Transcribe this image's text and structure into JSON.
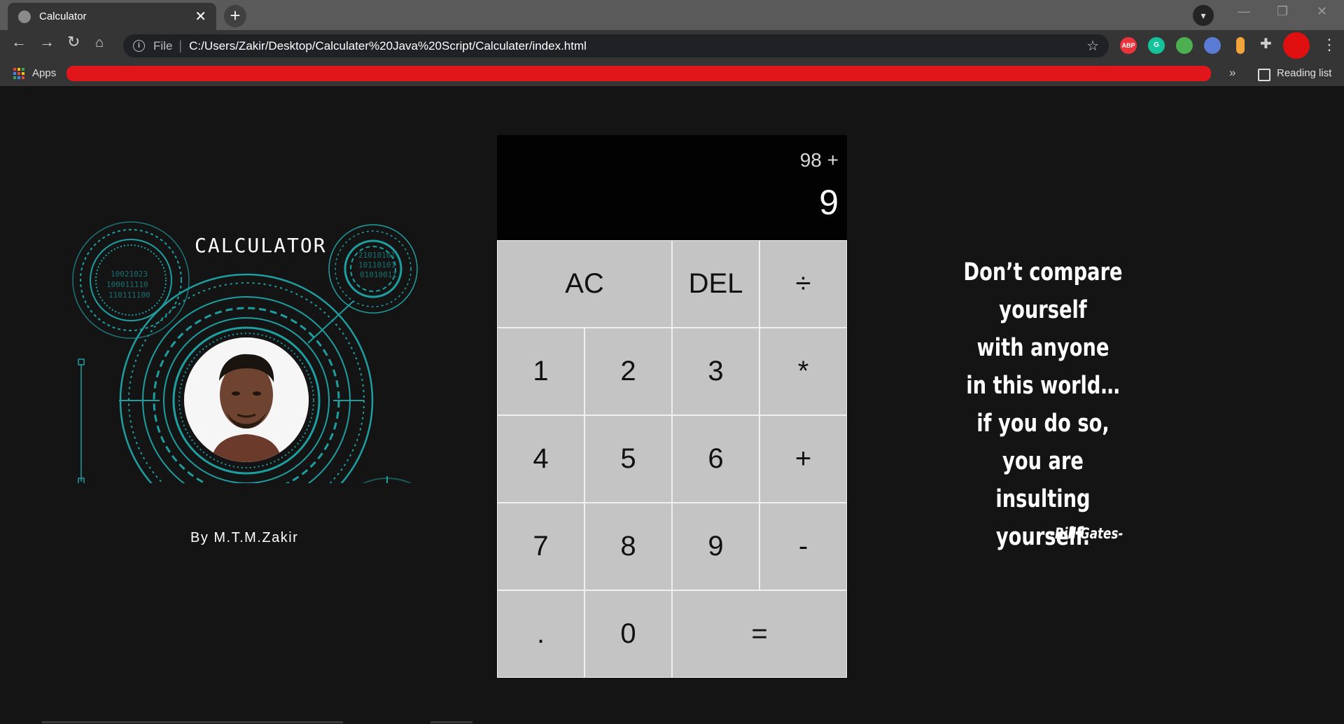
{
  "browser": {
    "tab_title": "Calculator",
    "tab_close": "✕",
    "new_tab": "+",
    "url_scheme_label": "File",
    "url": "C:/Users/Zakir/Desktop/Calculater%20Java%20Script/Calculater/index.html",
    "bookmarks_apps": "Apps",
    "bookmarks_more": "»",
    "reading_list": "Reading list",
    "extensions": [
      {
        "name": "adblock-plus-icon",
        "label": "ABP",
        "color": "#e8343a"
      },
      {
        "name": "grammarly-icon",
        "label": "G",
        "color": "#15c39a"
      },
      {
        "name": "color-picker-icon",
        "label": "",
        "color": "#4caf50"
      },
      {
        "name": "eyes-extension-icon",
        "label": "",
        "color": "#5b7bd5"
      },
      {
        "name": "pill-extension-icon",
        "label": "",
        "color": "#f2a33a"
      }
    ]
  },
  "art": {
    "title": "CALCULATOR",
    "byline": "By M.T.M.Zakir",
    "accent": "#1f9ea0"
  },
  "calculator": {
    "previous_operand": "98 +",
    "current_operand": "9",
    "keys": [
      "AC",
      "DEL",
      "÷",
      "1",
      "2",
      "3",
      "*",
      "4",
      "5",
      "6",
      "+",
      "7",
      "8",
      "9",
      "-",
      ".",
      "0",
      "="
    ]
  },
  "quote": {
    "lines": [
      "Don’t compare",
      "yourself",
      "with anyone",
      "in this world…",
      "if you do so,",
      "you are insulting",
      "yourself."
    ],
    "author": "-Bill Gates-"
  }
}
